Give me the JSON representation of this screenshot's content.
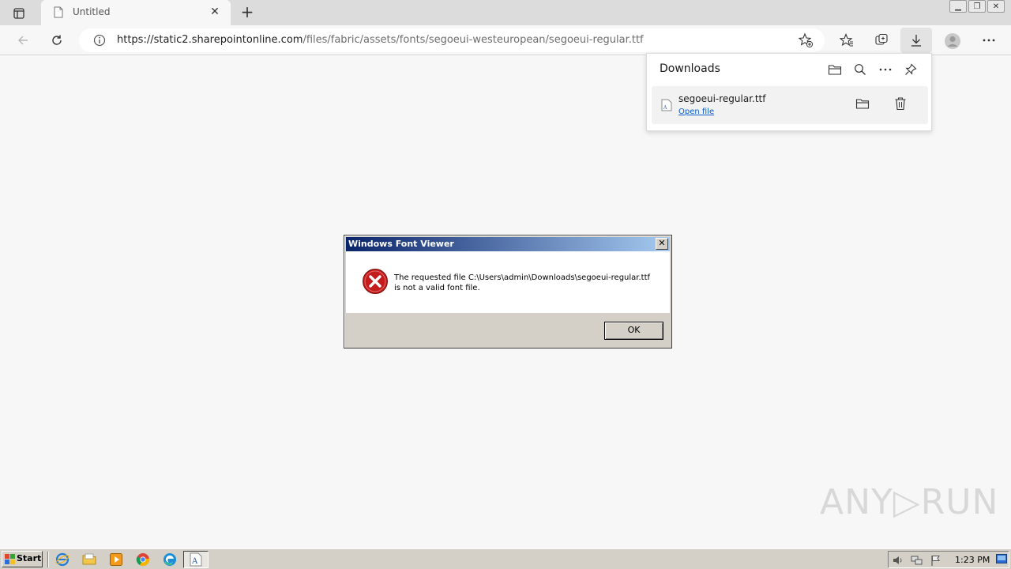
{
  "browser": {
    "tab": {
      "title": "Untitled"
    },
    "address": {
      "host": "https://static2.sharepointonline.com",
      "path": "/files/fabric/assets/fonts/segoeui-westeuropean/segoeui-regular.ttf"
    }
  },
  "downloads": {
    "title": "Downloads",
    "items": [
      {
        "filename": "segoeui-regular.ttf",
        "action": "Open file"
      }
    ]
  },
  "dialog": {
    "title": "Windows Font Viewer",
    "message_line1": "The requested file C:\\Users\\admin\\Downloads\\segoeui-regular.ttf",
    "message_line2": "is not a valid font file.",
    "ok_label": "OK",
    "close_glyph": "✕"
  },
  "watermark": "ANY▷RUN",
  "taskbar": {
    "start_label": "Start",
    "clock": "1:23 PM"
  }
}
